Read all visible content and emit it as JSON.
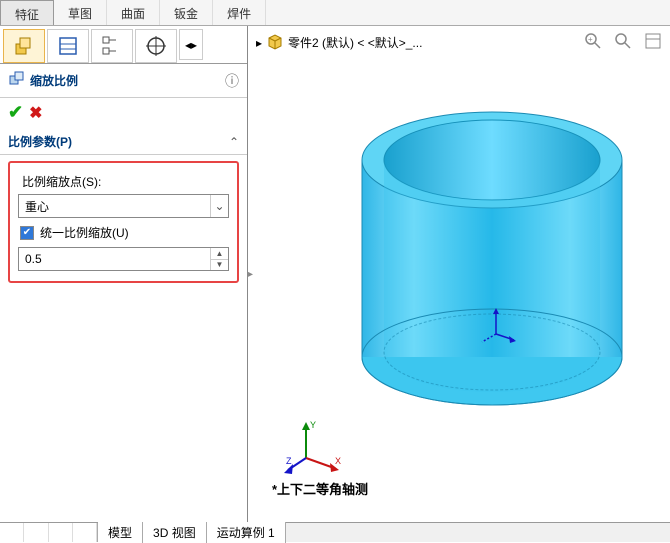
{
  "top_tabs": {
    "features": "特征",
    "sketch": "草图",
    "surface": "曲面",
    "sheet_metal": "钣金",
    "weldments": "焊件"
  },
  "feature": {
    "icon": "📐",
    "title": "缩放比例",
    "section_label": "比例参数(P)",
    "scale_point_label": "比例缩放点(S):",
    "scale_point_value": "重心",
    "uniform_label": "统一比例缩放(U)",
    "scale_value": "0.5"
  },
  "vp": {
    "expand": "▸",
    "part_icon": "📦",
    "part_label": "零件2 (默认) < <默认>_...",
    "view_label": "*上下二等角轴测"
  },
  "bottom_tabs": {
    "model": "模型",
    "view3d": "3D 视图",
    "motion": "运动算例 1"
  },
  "triad": {
    "x": "X",
    "y": "Y",
    "z": "Z"
  }
}
